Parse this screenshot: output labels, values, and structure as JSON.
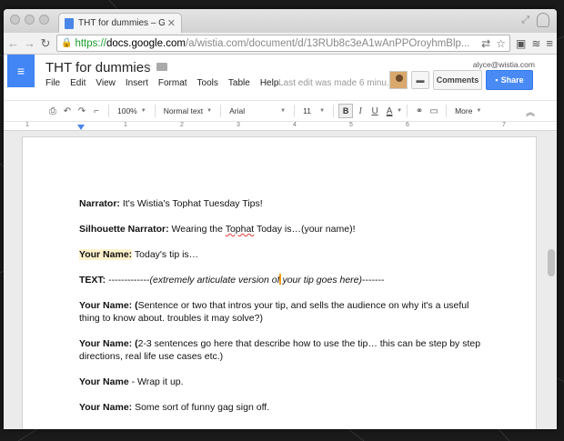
{
  "browser": {
    "tab_title": "THT for dummies – Googl",
    "url": {
      "scheme": "https://",
      "host": "docs.google.com",
      "path": "/a/wistia.com/document/d/13RUb8c3eA1wAnPPOroyhmBlp..."
    }
  },
  "docs": {
    "title": "THT for dummies",
    "user_email": "alyce@wistia.com",
    "menu": [
      "File",
      "Edit",
      "View",
      "Insert",
      "Format",
      "Tools",
      "Table",
      "Help"
    ],
    "last_edit": "Last edit was made 6 minu...",
    "comments_label": "Comments",
    "share_label": "Share"
  },
  "toolbar": {
    "zoom": "100%",
    "style": "Normal text",
    "font": "Arial",
    "size": "11",
    "bold": "B",
    "italic": "I",
    "underline": "U",
    "text_color": "A",
    "more": "More"
  },
  "ruler": [
    "1",
    "1",
    "2",
    "3",
    "4",
    "5",
    "6",
    "7"
  ],
  "document": {
    "p1_label": "Narrator:",
    "p1_text": " It's Wistia's Tophat Tuesday Tips!",
    "p2_label": "Silhouette Narrator:",
    "p2_text_a": " Wearing the ",
    "p2_squiggle": "Tophat",
    "p2_text_b": " Today is…(your name)!",
    "p3_label": "Your Name:",
    "p3_text": " Today's tip is…",
    "p4_label": "TEXT:",
    "p4_dashes": " -------------",
    "p4_italic_a": "(extremely articulate version of",
    "p4_italic_b": " your tip goes here)",
    "p4_dashes_end": "-------",
    "p5_label": "Your Name: (",
    "p5_text": "Sentence or two that intros your tip, and sells the audience on why it's a useful thing to know about. troubles it may solve?)",
    "p6_label": "Your Name: (",
    "p6_text": "2-3 sentences go here that describe how to use the tip… this can be step by step directions, real life use cases etc.)",
    "p7_label": "Your Name",
    "p7_text": " - Wrap it up.",
    "p8_label": "Your Name:",
    "p8_text": "  Some sort of funny gag sign off."
  }
}
